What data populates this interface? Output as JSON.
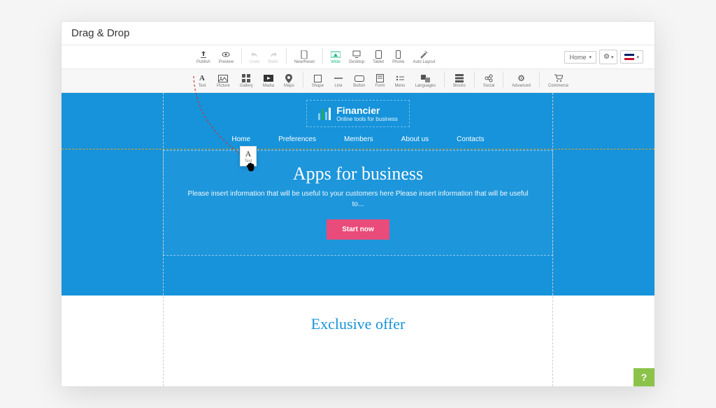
{
  "window_title": "Drag & Drop",
  "toolbar1": {
    "publish": "Publish",
    "preview": "Preview",
    "undo": "Undo",
    "redo": "Redo",
    "newreset": "New/Reset",
    "wide": "Wide",
    "desktop": "Desktop",
    "tablet": "Tablet",
    "phone": "Phone",
    "autolayout": "Auto Layout"
  },
  "page_dropdown": "Home",
  "elements": {
    "text": "Text",
    "picture": "Picture",
    "gallery": "Gallery",
    "media": "Media",
    "maps": "Maps",
    "shape": "Shape",
    "line": "Line",
    "button": "Button",
    "form": "Form",
    "menu": "Menu",
    "languages": "Languages",
    "blocks": "Blocks",
    "social": "Social",
    "advanced": "Advanced",
    "commerce": "Commerce"
  },
  "site": {
    "brand_name": "Financier",
    "brand_tagline": "Online tools for business",
    "nav": [
      "Home",
      "Preferences",
      "Members",
      "About us",
      "Contacts"
    ],
    "hero_title": "Apps for business",
    "hero_text": "Please insert information that will be useful to your customers here Please insert information that will be useful to...",
    "cta": "Start now",
    "section2_title": "Exclusive offer"
  },
  "drag_ghost_label": "Text",
  "help": "?"
}
